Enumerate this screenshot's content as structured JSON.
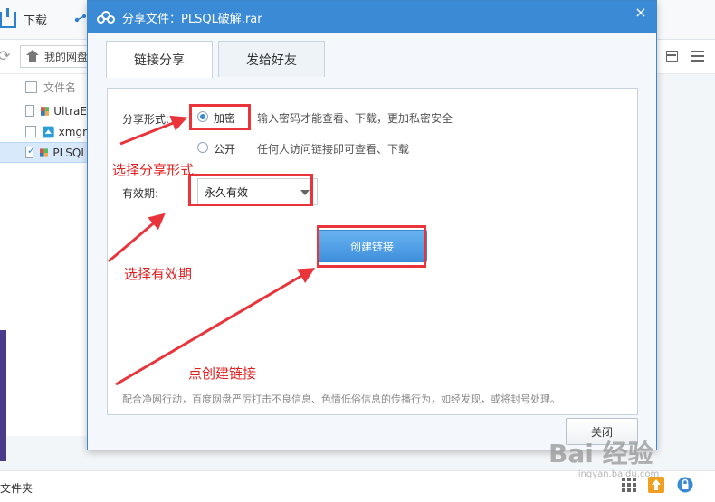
{
  "background": {
    "download_label": "下载",
    "path_label": "我的网盘",
    "column_header": "文件名",
    "files": [
      {
        "name": "UltraE",
        "icon": "rar-icon",
        "checked": false
      },
      {
        "name": "xmgr",
        "icon": "installer-icon",
        "checked": false
      },
      {
        "name": "PLSQL",
        "icon": "rar-icon",
        "checked": true
      }
    ],
    "bottom_label": "文件夹"
  },
  "dialog": {
    "title": "分享文件：PLSQL破解.rar",
    "close_symbol": "×",
    "tabs": [
      {
        "label": "链接分享",
        "active": true
      },
      {
        "label": "发给好友",
        "active": false
      }
    ],
    "share_form_label": "分享形式:",
    "options": [
      {
        "label": "加密",
        "desc": "输入密码才能查看、下载，更加私密安全",
        "selected": true
      },
      {
        "label": "公开",
        "desc": "任何人访问链接即可查看、下载",
        "selected": false
      }
    ],
    "validity_label": "有效期:",
    "validity_value": "永久有效",
    "create_button": "创建链接",
    "notice": "配合净网行动，百度网盘严厉打击不良信息、色情低俗信息的传播行为，如经发现，或将封号处理。",
    "close_button": "关闭"
  },
  "annotations": {
    "select_form": "选择分享形式",
    "select_validity": "选择有效期",
    "click_create": "点创建链接",
    "color": "#e02020"
  },
  "watermark": {
    "main": "Bai 经验",
    "sub": "jingyan.baidu.com"
  }
}
